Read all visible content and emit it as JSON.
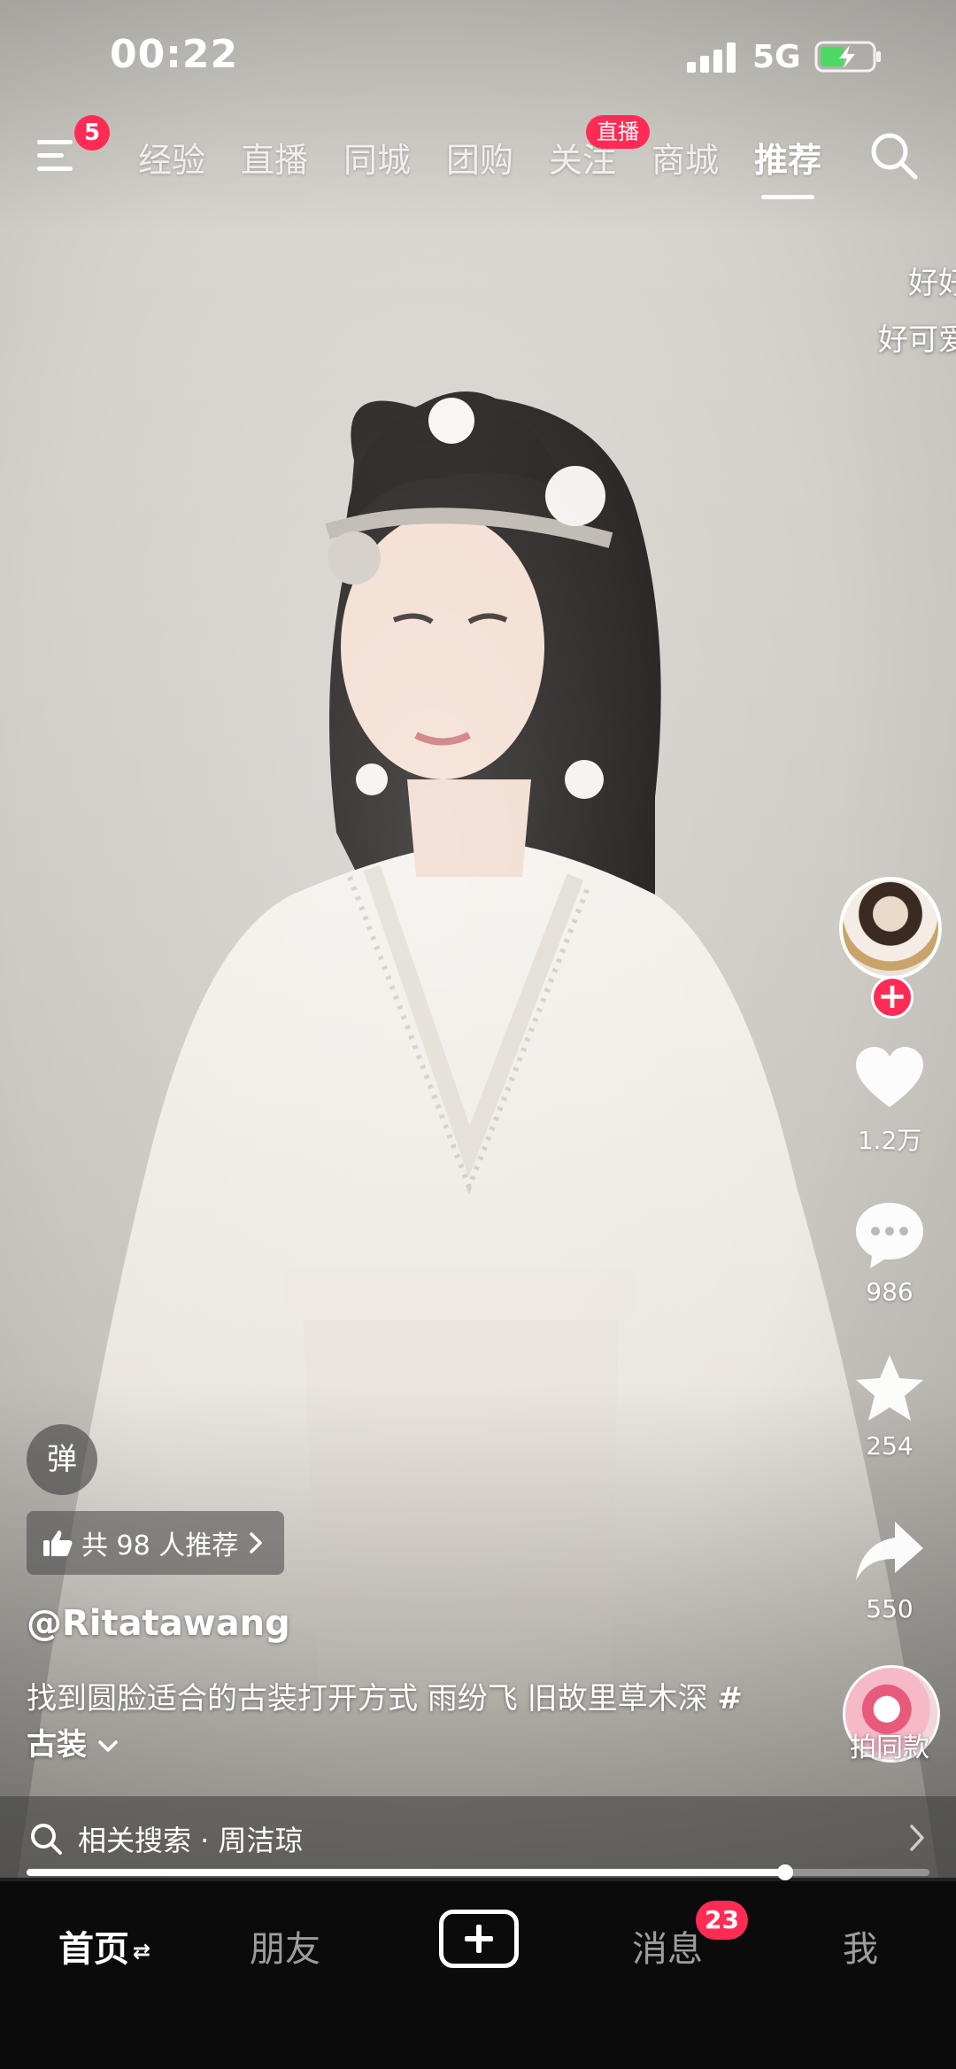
{
  "status_bar": {
    "time": "00:22",
    "network": "5G",
    "signal_icon": "signal-bars-icon",
    "battery_icon": "battery-charging-icon",
    "battery_color": "#4cd964"
  },
  "top_nav": {
    "menu_badge": "5",
    "tabs": [
      "经验",
      "直播",
      "同城",
      "团购",
      "关注",
      "商城",
      "推荐"
    ],
    "active_tab": "推荐",
    "live_badge": "直播",
    "search_icon": "search-icon"
  },
  "danmaku": [
    "好好",
    "好可爱"
  ],
  "actions": {
    "like_count": "1.2万",
    "comment_count": "986",
    "favorite_count": "254",
    "share_count": "550",
    "remix_label": "拍同款",
    "follow_symbol": "+"
  },
  "video_info": {
    "danmu_toggle": "弹",
    "recommend_text": "共 98 人推荐",
    "author": "@Ritatawang",
    "caption_text": "找到圆脸适合的古装打开方式 雨纷飞 旧故里草木深 ",
    "caption_tag": "#古装",
    "related_search": "相关搜索 · 周洁琼",
    "progress": 0.84
  },
  "tab_bar": {
    "home": "首页",
    "friends": "朋友",
    "messages": "消息",
    "messages_badge": "23",
    "me": "我"
  },
  "colors": {
    "accent": "#fe2c55",
    "tab_bar_bg": "#0b0b0b"
  }
}
